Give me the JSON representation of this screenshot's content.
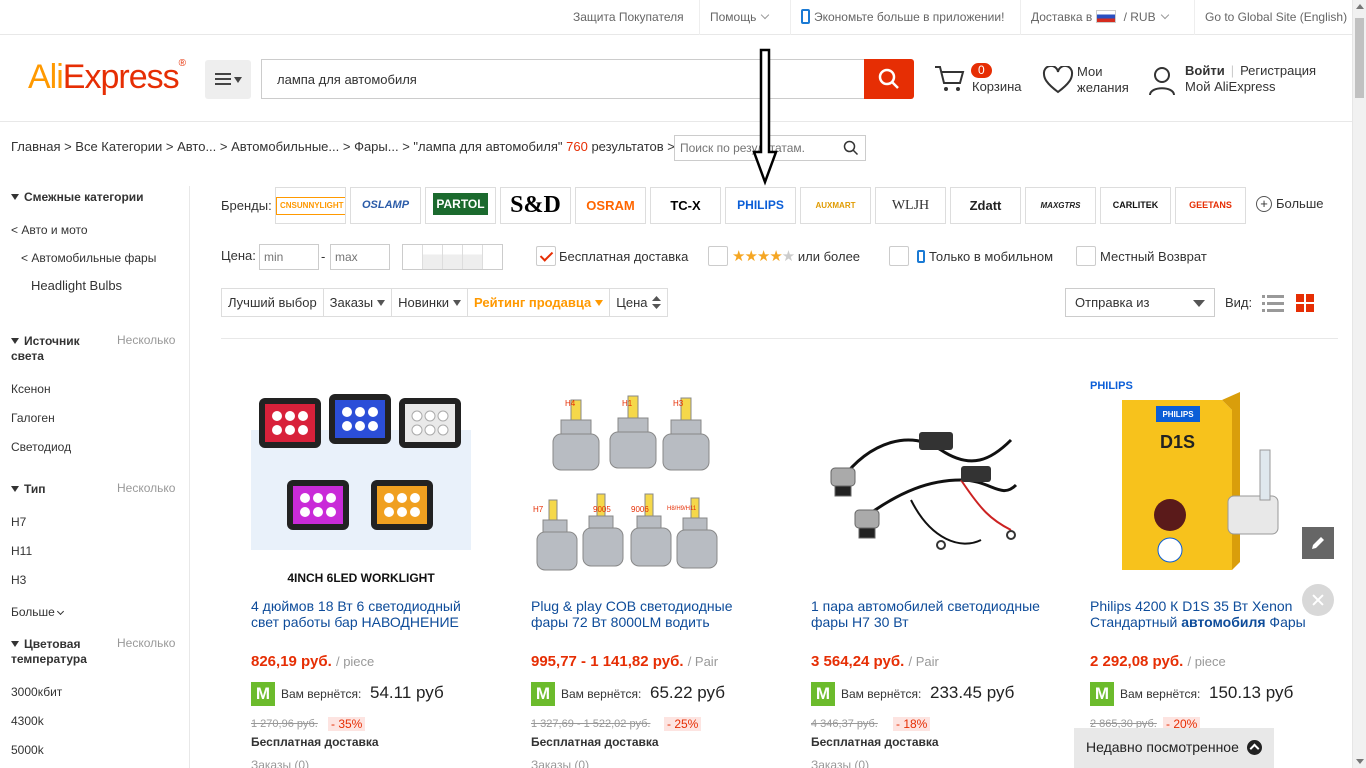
{
  "topbar": {
    "buyer_protection": "Защита Покупателя",
    "help": "Помощь",
    "app": "Экономьте больше в приложении!",
    "delivery": "Доставка в",
    "currency": "RUB",
    "global": "Go to Global Site (English)"
  },
  "header": {
    "logo_a": "Ali",
    "logo_b": "Express",
    "search_value": "лампа для автомобиля",
    "cart_count": "0",
    "cart_label": "Корзина",
    "wishlist_label": "Мои желания",
    "login": "Войти",
    "register": "Регистрация",
    "my_account": "Мой AliExpress"
  },
  "breadcrumb": {
    "text": "Главная > Все Категории > Авто... > Автомобильные... > Фары... > \"лампа для автомобиля\"",
    "count": "760",
    "results": "результатов >",
    "search_placeholder": "Поиск по результатам."
  },
  "sidebar": {
    "related": "Смежные категории",
    "auto": "< Авто и мото",
    "headlights": "< Автомобильные фары",
    "bulbs": "Headlight Bulbs",
    "source": "Источник света",
    "several": "Несколько",
    "xenon": "Ксенон",
    "halogen": "Галоген",
    "led": "Светодиод",
    "type": "Тип",
    "h7": "H7",
    "h11": "H11",
    "h3": "H3",
    "more": "Больше",
    "color_temp": "Цветовая температура",
    "t3000": "3000кбит",
    "t4300": "4300k",
    "t5000": "5000k"
  },
  "filters": {
    "brands_label": "Бренды:",
    "brands": [
      "CNSUNNYLIGHT",
      "OSLAMP",
      "PARTOL",
      "S&D",
      "OSRAM",
      "TC-X",
      "PHILIPS",
      "AUXMART",
      "WLJH",
      "Zdatt",
      "MAXGTRS",
      "CARLITEK",
      "GEETANS"
    ],
    "more": "Больше",
    "price_label": "Цена:",
    "min": "min",
    "max": "max",
    "free_shipping": "Бесплатная доставка",
    "or_more": "или более",
    "mobile_only": "Только в мобильном",
    "local_return": "Местный Возврат",
    "stars_on": "★★★★",
    "stars_off": "★"
  },
  "sort": {
    "best": "Лучший выбор",
    "orders": "Заказы",
    "new": "Новинки",
    "seller_rating": "Рейтинг продавца",
    "price": "Цена",
    "ship_from": "Отправка из",
    "view": "Вид:"
  },
  "products": [
    {
      "img_caption": "4INCH 6LED WORKLIGHT",
      "title": "4 дюймов 18 Вт 6 светодиодный свет работы бар НАВОДНЕНИЕ",
      "price": "826,19 руб.",
      "unit": "/ piece",
      "cashback_label": "Вам вернётся:",
      "cashback": "54.11 руб",
      "old": "1 270,96 руб.",
      "disc": "- 35%",
      "free": "Бесплатная доставка",
      "orders": "Заказы (0)"
    },
    {
      "img_caption": "",
      "title": "Plug & play COB светодиодные фары 72 Вт 8000LM водить",
      "price": "995,77 - 1 141,82 руб.",
      "unit": "/ Pair",
      "cashback_label": "Вам вернётся:",
      "cashback": "65.22 руб",
      "old": "1 327,69 - 1 522,02 руб.",
      "disc": "- 25%",
      "free": "Бесплатная доставка",
      "orders": "Заказы (0)"
    },
    {
      "img_caption": "",
      "title": "1 пара автомобилей светодиодные фары H7 30 Вт",
      "price": "3 564,24 руб.",
      "unit": "/ Pair",
      "cashback_label": "Вам вернётся:",
      "cashback": "233.45 руб",
      "old": "4 346,37 руб.",
      "disc": "- 18%",
      "free": "Бесплатная доставка",
      "orders": "Заказы (0)"
    },
    {
      "img_caption": "PHILIPS",
      "title_a": "Philips 4200 К D1S 35 Вт Xenon Стандартный ",
      "title_b": "автомобиля",
      "title_c": " Фары",
      "price": "2 292,08 руб.",
      "unit": "/ piece",
      "cashback_label": "Вам вернётся:",
      "cashback": "150.13 руб",
      "old": "2 865,30 руб.",
      "disc": "- 20%",
      "free": "",
      "orders": ""
    }
  ],
  "bulb_labels": [
    "H4",
    "H1",
    "H3",
    "H7",
    "9005",
    "9006",
    "H8/H9/H11"
  ],
  "recent": "Недавно посмотренное",
  "colors": {
    "accent": "#e62e04",
    "orange": "#ff9900",
    "link": "#0e4c9a",
    "cashback": "#6cbb2c"
  }
}
